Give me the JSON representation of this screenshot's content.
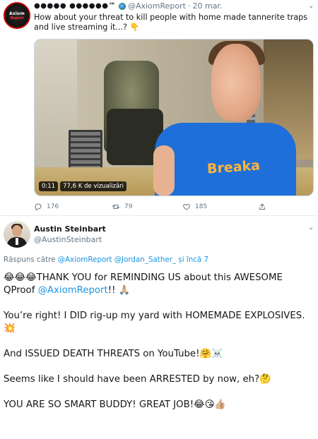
{
  "colors": {
    "link": "#1b95e0",
    "muted": "#657786",
    "text": "#14171a",
    "shirt": "#1e6fd9"
  },
  "tweet": {
    "avatar_label_top": "Axiom",
    "avatar_label_bottom": "Report",
    "display_name": "●●●●● ●●●●●●™",
    "handle": "@AxiomReport",
    "separator": "·",
    "date": "20 mar.",
    "text": "How about your threat to kill people with home made tannerite traps and live streaming it...? 👇",
    "video": {
      "duration": "0:11",
      "views": "77,6 K de vizualizări",
      "shirt_text": "Breaka"
    },
    "actions": {
      "reply_count": "176",
      "retweet_count": "79",
      "like_count": "185"
    }
  },
  "reply": {
    "display_name": "Austin Steinbart",
    "handle": "@AustinSteinbart",
    "replying_prefix": "Răspuns către",
    "replying_mention_1": "@AxiomReport",
    "replying_mention_2": "@Jordan_Sather_",
    "replying_suffix": "și încă 7",
    "p1_a": "😂😂😂THANK YOU for REMINDING US about this AWESOME QProof ",
    "p1_mention": "@AxiomReport",
    "p1_b": "!! 🙏🏼",
    "p2": "You’re right! I DID rig-up my yard with HOMEMADE EXPLOSIVES.💥",
    "p3": "And ISSUED DEATH THREATS on YouTube!🤗☠️",
    "p4": "Seems like I should have been ARRESTED by now, eh?🤔",
    "p5": "YOU ARE SO SMART BUDDY! GREAT JOB!😂😘👍🏼"
  }
}
